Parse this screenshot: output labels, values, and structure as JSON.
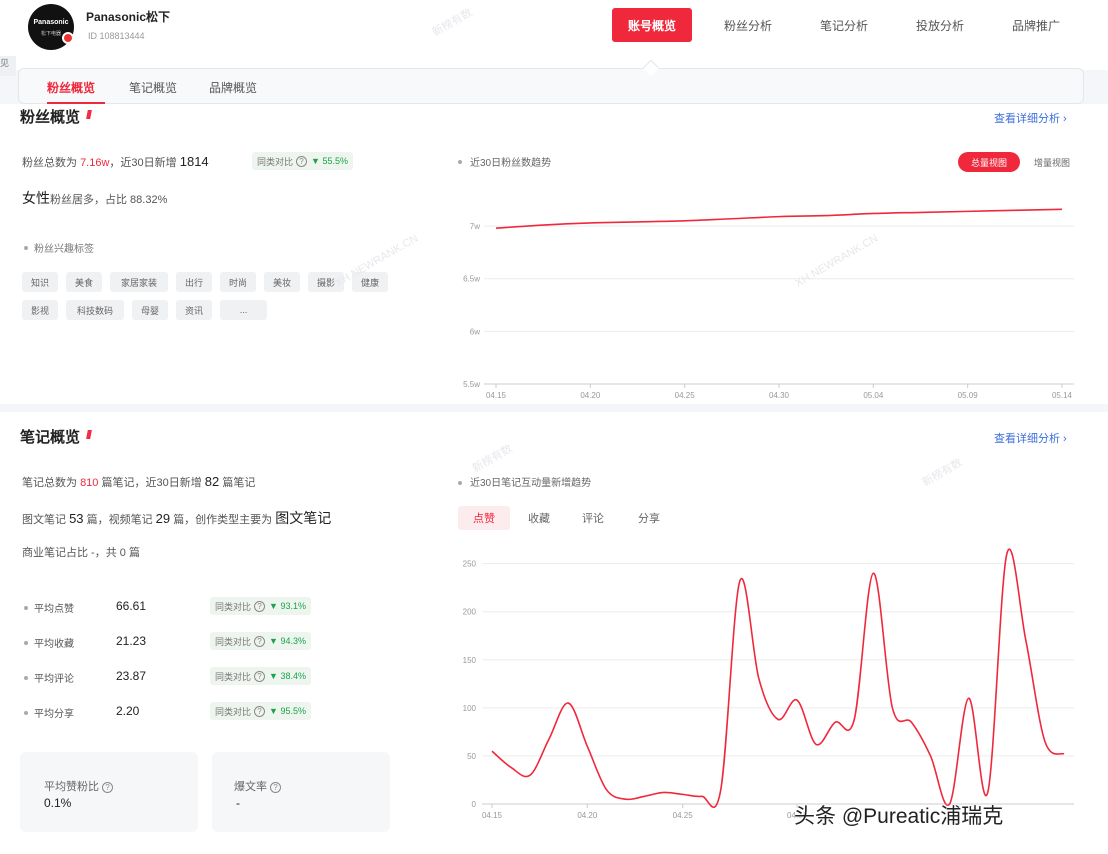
{
  "account": {
    "name": "Panasonic松下",
    "id": "ID 108813444",
    "logo_text": "Panasonic",
    "logo_sub": "松下电器"
  },
  "nav": [
    "账号概览",
    "粉丝分析",
    "笔记分析",
    "投放分析",
    "品牌推广"
  ],
  "subtabs": [
    "粉丝概览",
    "笔记概览",
    "品牌概览"
  ],
  "left_strip": "见",
  "fans": {
    "title": "粉丝概览",
    "more": "查看详细分析 ›",
    "total_label": "粉丝总数为",
    "total_value": "7.16w",
    "new_label": "，近30日新增",
    "new_value": "1814",
    "compare_label": "同类对比",
    "compare_value": "55.5%",
    "gender_word": "女性",
    "gender_rest": "粉丝居多，占比 88.32%",
    "interest_title": "粉丝兴趣标签",
    "tags_row1": [
      "知识",
      "美食",
      "家居家装",
      "出行",
      "时尚",
      "美妆",
      "摄影",
      "健康"
    ],
    "tags_row2": [
      "影视",
      "科技数码",
      "母婴",
      "资讯",
      "..."
    ],
    "chart_title": "近30日粉丝数趋势",
    "btn_on": "总量视图",
    "btn_off": "增量视图"
  },
  "notes": {
    "title": "笔记概览",
    "more": "查看详细分析 ›",
    "line1_a": "笔记总数为",
    "line1_v": "810",
    "line1_b": "篇笔记，近30日新增",
    "line1_v2": "82",
    "line1_c": "篇笔记",
    "line2_a": "图文笔记",
    "line2_v": "53",
    "line2_b": "篇，视频笔记",
    "line2_v2": "29",
    "line2_c": "篇，创作类型主要为",
    "line2_type": "图文笔记",
    "line3": "商业笔记占比 -，共 0 篇",
    "metrics": [
      {
        "label": "平均点赞",
        "value": "66.61",
        "compare": "93.1%"
      },
      {
        "label": "平均收藏",
        "value": "21.23",
        "compare": "94.3%"
      },
      {
        "label": "平均评论",
        "value": "23.87",
        "compare": "38.4%"
      },
      {
        "label": "平均分享",
        "value": "2.20",
        "compare": "95.5%"
      }
    ],
    "compare_label": "同类对比",
    "card1_label": "平均赞粉比",
    "card1_value": "0.1%",
    "card2_label": "爆文率",
    "card2_value": "-",
    "chart_title": "近30日笔记互动量新增趋势",
    "tabs": [
      "点赞",
      "收藏",
      "评论",
      "分享"
    ]
  },
  "watermarks": [
    "新榜有数",
    "XH.NEWRANK.CN",
    "XH.NEWRANK.CN",
    "新榜有数",
    "新榜有数"
  ],
  "footer_credit": "头条 @Pureatic浦瑞克",
  "chart_data": [
    {
      "type": "line",
      "title": "近30日粉丝数趋势",
      "x": [
        "04.15",
        "04.20",
        "04.25",
        "04.30",
        "05.04",
        "05.09",
        "05.14"
      ],
      "y_ticks": [
        "5.5w",
        "6w",
        "6.5w",
        "7w"
      ],
      "ylim": [
        55000,
        74000
      ],
      "series": [
        {
          "values": [
            69800,
            70100,
            70300,
            70400,
            70500,
            70700,
            70900,
            71000,
            71200,
            71300,
            71400,
            71500,
            71600
          ]
        }
      ],
      "color": "#f0283c",
      "grid": true
    },
    {
      "type": "line",
      "title": "近30日笔记互动量新增趋势",
      "x_ticks": [
        "04.15",
        "04.20",
        "04.25",
        "04.30"
      ],
      "y_ticks": [
        "0",
        "50",
        "100",
        "150",
        "200",
        "250"
      ],
      "ylim": [
        0,
        260
      ],
      "series": [
        {
          "values": [
            55,
            38,
            30,
            68,
            105,
            60,
            15,
            5,
            8,
            12,
            10,
            8,
            15,
            232,
            130,
            88,
            108,
            62,
            85,
            88,
            240,
            100,
            85,
            50,
            0,
            110,
            12,
            260,
            170,
            65,
            52
          ]
        }
      ],
      "color": "#f0283c",
      "grid": true
    }
  ]
}
